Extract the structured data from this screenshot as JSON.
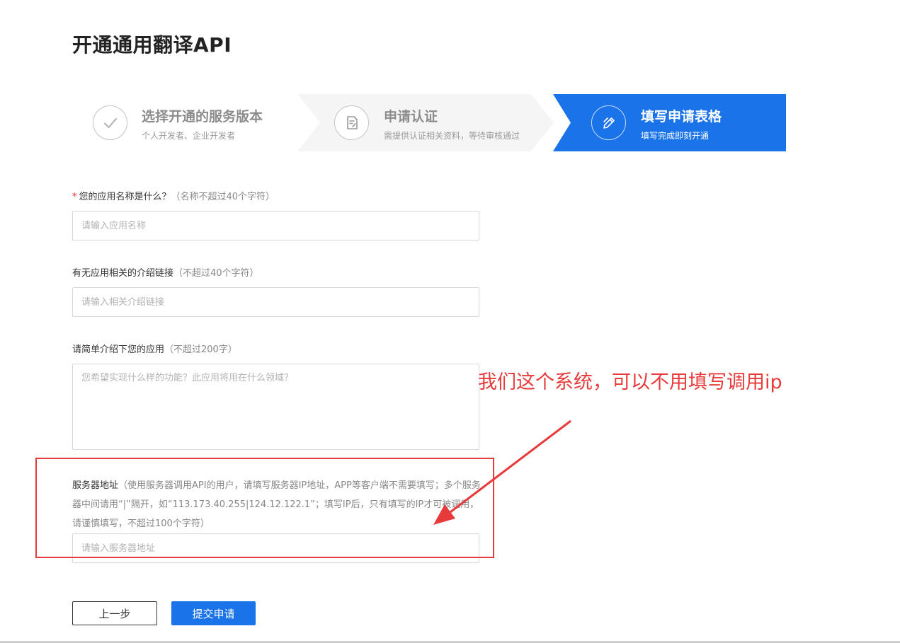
{
  "page": {
    "title": "开通通用翻译API"
  },
  "steps": [
    {
      "title": "选择开通的服务版本",
      "desc": "个人开发者、企业开发者",
      "icon": "check-icon",
      "state": "done"
    },
    {
      "title": "申请认证",
      "desc": "需提供认证相关资料，等待审核通过",
      "icon": "document-edit-icon",
      "state": "done"
    },
    {
      "title": "填写申请表格",
      "desc": "填写完成即刻开通",
      "icon": "pencil-icon",
      "state": "active"
    }
  ],
  "form": {
    "app_name": {
      "required_mark": "*",
      "label": "您的应用名称是什么？",
      "hint": "（名称不超过40个字符）",
      "placeholder": "请输入应用名称",
      "value": ""
    },
    "intro_link": {
      "label": "有无应用相关的介绍链接",
      "hint": "（不超过40个字符）",
      "placeholder": "请输入相关介绍链接",
      "value": ""
    },
    "app_desc": {
      "label": "请简单介绍下您的应用",
      "hint": "（不超过200字）",
      "placeholder": "您希望实现什么样的功能？此应用将用在什么领域？",
      "value": ""
    },
    "server_address": {
      "label": "服务器地址",
      "hint": "（使用服务器调用API的用户，请填写服务器IP地址，APP等客户端不需要填写；多个服务器中间请用“|”隔开，如“113.173.40.255|124.12.122.1”；填写IP后，只有填写的IP才可被调用，请谨慎填写，不超过100个字符）",
      "placeholder": "请输入服务器地址",
      "value": ""
    }
  },
  "buttons": {
    "back": "上一步",
    "submit": "提交申请"
  },
  "annotation": {
    "text": "我们这个系统，可以不用填写调用ip",
    "color": "#e83a3a"
  },
  "colors": {
    "accent": "#1a73e8",
    "inactive_step_bg": "#f5f5f5",
    "required": "#f5222d"
  }
}
